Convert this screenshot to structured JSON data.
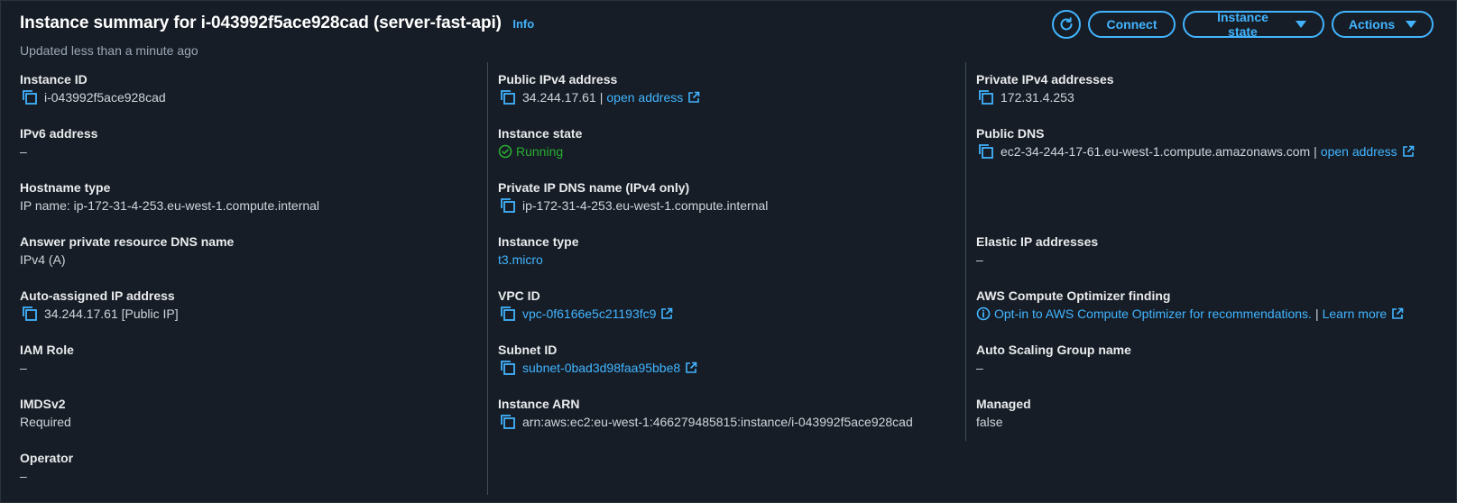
{
  "header": {
    "title": "Instance summary for i-043992f5ace928cad (server-fast-api)",
    "info": "Info",
    "subtitle": "Updated less than a minute ago"
  },
  "toolbar": {
    "refresh_icon": "refresh-icon",
    "connect": "Connect",
    "instance_state": "Instance state",
    "actions": "Actions"
  },
  "col1": {
    "instance_id": {
      "label": "Instance ID",
      "value": "i-043992f5ace928cad"
    },
    "ipv6": {
      "label": "IPv6 address",
      "value": "–"
    },
    "hostname_type": {
      "label": "Hostname type",
      "value": "IP name: ip-172-31-4-253.eu-west-1.compute.internal"
    },
    "answer_dns": {
      "label": "Answer private resource DNS name",
      "value": "IPv4 (A)"
    },
    "auto_ip": {
      "label": "Auto-assigned IP address",
      "value": "34.244.17.61 [Public IP]"
    },
    "iam_role": {
      "label": "IAM Role",
      "value": "–"
    },
    "imdsv2": {
      "label": "IMDSv2",
      "value": "Required"
    },
    "operator": {
      "label": "Operator",
      "value": "–"
    }
  },
  "col2": {
    "public_ipv4": {
      "label": "Public IPv4 address",
      "value": "34.244.17.61",
      "sep": "|",
      "link": "open address"
    },
    "instance_state": {
      "label": "Instance state",
      "value": "Running"
    },
    "private_dns": {
      "label": "Private IP DNS name (IPv4 only)",
      "value": "ip-172-31-4-253.eu-west-1.compute.internal"
    },
    "instance_type": {
      "label": "Instance type",
      "value": "t3.micro"
    },
    "vpc_id": {
      "label": "VPC ID",
      "value": "vpc-0f6166e5c21193fc9"
    },
    "subnet_id": {
      "label": "Subnet ID",
      "value": "subnet-0bad3d98faa95bbe8"
    },
    "arn": {
      "label": "Instance ARN",
      "value": "arn:aws:ec2:eu-west-1:466279485815:instance/i-043992f5ace928cad"
    }
  },
  "col3": {
    "private_ipv4": {
      "label": "Private IPv4 addresses",
      "value": "172.31.4.253"
    },
    "public_dns": {
      "label": "Public DNS",
      "value": "ec2-34-244-17-61.eu-west-1.compute.amazonaws.com",
      "sep": "|",
      "link": "open address"
    },
    "elastic_ip": {
      "label": "Elastic IP addresses",
      "value": "–"
    },
    "optimizer": {
      "label": "AWS Compute Optimizer finding",
      "value": "Opt-in to AWS Compute Optimizer for recommendations.",
      "sep": "|",
      "link": "Learn more"
    },
    "asg": {
      "label": "Auto Scaling Group name",
      "value": "–"
    },
    "managed": {
      "label": "Managed",
      "value": "false"
    }
  },
  "colors": {
    "background": "#161d26",
    "link": "#42b4ff",
    "success": "#29ad32"
  }
}
